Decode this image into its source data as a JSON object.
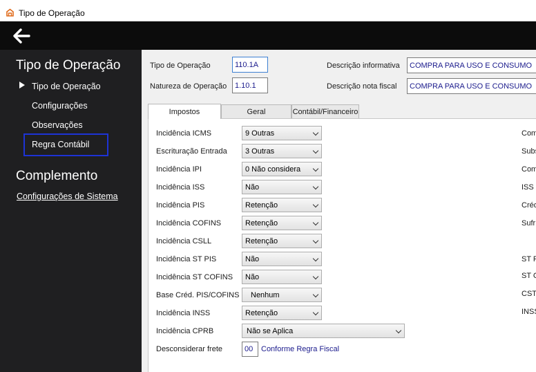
{
  "window": {
    "title": "Tipo de Operação"
  },
  "sidebar": {
    "heading1": "Tipo de Operação",
    "items": [
      "Tipo de Operação",
      "Configurações",
      "Observações",
      "Regra Contábil"
    ],
    "heading2": "Complemento",
    "link": "Configurações de Sistema"
  },
  "header": {
    "tipo_label": "Tipo de Operação",
    "tipo_value": "110.1A",
    "natureza_label": "Natureza de Operação",
    "natureza_value": "1.10.1",
    "desc_info_label": "Descrição informativa",
    "desc_info_value": "COMPRA PARA USO E CONSUMO",
    "desc_nf_label": "Descrição nota fiscal",
    "desc_nf_value": "COMPRA PARA USO E CONSUMO"
  },
  "tabs": [
    "Impostos",
    "Geral",
    "Contábil/Financeiro"
  ],
  "impostos": {
    "rows": [
      {
        "label": "Incidência ICMS",
        "value": "9 Outras"
      },
      {
        "label": "Escrituração Entrada",
        "value": "3 Outras"
      },
      {
        "label": "Incidência IPI",
        "value": "0 Não considera"
      },
      {
        "label": "Incidência ISS",
        "value": "Não"
      },
      {
        "label": "Incidência PIS",
        "value": "Retenção"
      },
      {
        "label": "Incidência COFINS",
        "value": "Retenção"
      },
      {
        "label": "Incidência CSLL",
        "value": "Retenção"
      },
      {
        "label": "Incidência ST PIS",
        "value": "Não"
      },
      {
        "label": "Incidência ST COFINS",
        "value": "Não"
      },
      {
        "label": "Base Créd. PIS/COFINS",
        "value": "Nenhum"
      },
      {
        "label": "Incidência INSS",
        "value": "Retenção"
      }
    ],
    "cprb_label": "Incidência CPRB",
    "cprb_value": "Não se Aplica",
    "frete_label": "Desconsiderar frete",
    "frete_code": "00",
    "frete_desc": "Conforme Regra Fiscal",
    "right_labels": [
      "Com",
      "Subs",
      "Com",
      "ISS",
      "Créd",
      "Sufr",
      "ST P",
      "ST C",
      "CST",
      "INSS"
    ]
  }
}
